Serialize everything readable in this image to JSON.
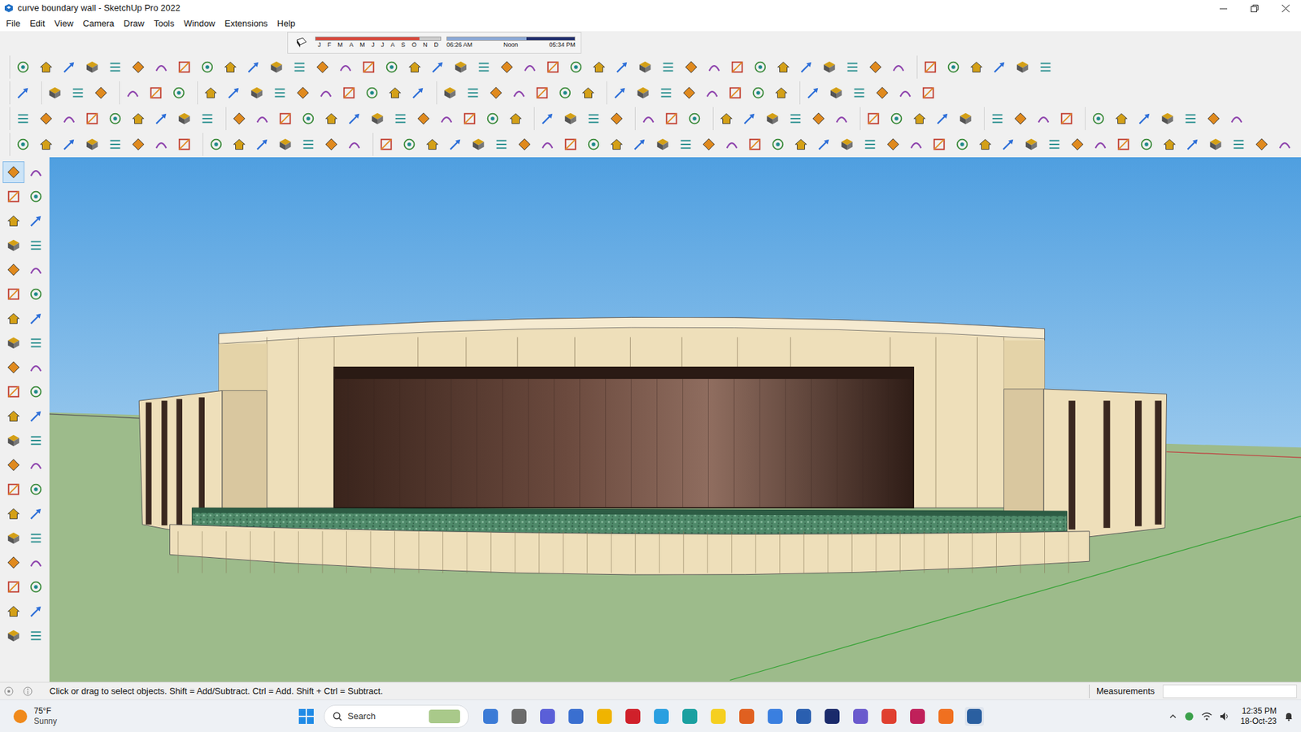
{
  "window": {
    "title": "curve boundary wall - SketchUp Pro 2022"
  },
  "menu": [
    "File",
    "Edit",
    "View",
    "Camera",
    "Draw",
    "Tools",
    "Window",
    "Extensions",
    "Help"
  ],
  "shadows": {
    "months": [
      "J",
      "F",
      "M",
      "A",
      "M",
      "J",
      "J",
      "A",
      "S",
      "O",
      "N",
      "D"
    ],
    "date_level": 0.83,
    "times": [
      "06:26 AM",
      "Noon",
      "05:34 PM"
    ],
    "time_level": 0.62
  },
  "select_tool": {
    "selected": true
  },
  "status_bar": {
    "hint": "Click or drag to select objects. Shift = Add/Subtract. Ctrl = Add. Shift + Ctrl = Subtract.",
    "measurements_label": "Measurements"
  },
  "taskbar": {
    "weather": {
      "temp": "75°F",
      "condition": "Sunny"
    },
    "search_placeholder": "Search",
    "time": "12:35 PM",
    "date": "18-Oct-23"
  }
}
